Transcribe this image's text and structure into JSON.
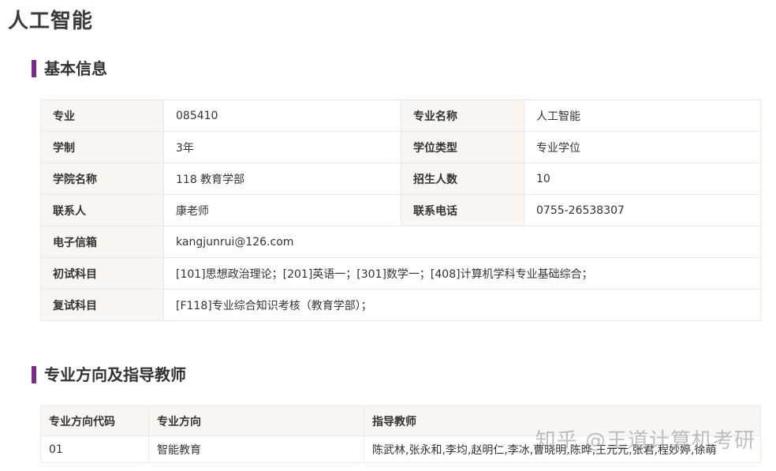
{
  "page_title": "人工智能",
  "sections": {
    "basic_info": "基本信息",
    "directions": "专业方向及指导教师"
  },
  "info": {
    "major_code_label": "专业",
    "major_code": "085410",
    "major_name_label": "专业名称",
    "major_name": "人工智能",
    "duration_label": "学制",
    "duration": "3年",
    "degree_type_label": "学位类型",
    "degree_type": "专业学位",
    "college_label": "学院名称",
    "college": "118 教育学部",
    "enrollment_label": "招生人数",
    "enrollment": "10",
    "contact_label": "联系人",
    "contact": "康老师",
    "phone_label": "联系电话",
    "phone": "0755-26538307",
    "email_label": "电子信箱",
    "email": "kangjunrui@126.com",
    "prelim_label": "初试科目",
    "prelim": "[101]思想政治理论；[201]英语一；[301]数学一；[408]计算机学科专业基础综合；",
    "retest_label": "复试科目",
    "retest": "[F118]专业综合知识考核（教育学部）；"
  },
  "directions_table": {
    "headers": [
      "专业方向代码",
      "专业方向",
      "指导教师"
    ],
    "rows": [
      {
        "code": "01",
        "direction": "智能教育",
        "advisors": "陈武林,张永和,李均,赵明仁,李冰,曹晓明,陈晔,王元元,张君,程妙婷,徐萌"
      }
    ]
  },
  "watermark": "知乎 @王道计算机考研",
  "colors": {
    "accent": "#7b2d8e",
    "link": "#b28ac8",
    "label_bg": "#f8f5f2",
    "border": "#efe8e0"
  }
}
